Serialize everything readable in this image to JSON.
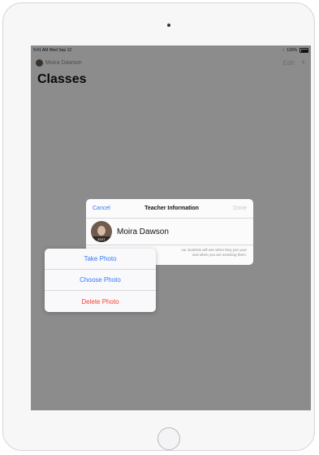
{
  "status_bar": {
    "time_date": "9:41 AM  Wed Sep 12",
    "battery": "100%"
  },
  "nav": {
    "user_name": "Moira Dawson",
    "edit_label": "Edit",
    "add_symbol": "+"
  },
  "page": {
    "title": "Classes"
  },
  "modal": {
    "cancel_label": "Cancel",
    "title": "Teacher Information",
    "done_label": "Done",
    "teacher_name": "Moira Dawson",
    "avatar_edit_label": "EDIT",
    "note_line1": "our students will see when they join your",
    "note_line2": "and when you are assisting them."
  },
  "photo_menu": {
    "take_photo": "Take Photo",
    "choose_photo": "Choose Photo",
    "delete_photo": "Delete Photo"
  },
  "colors": {
    "accent": "#3478f6",
    "destructive": "#ff3b30"
  }
}
